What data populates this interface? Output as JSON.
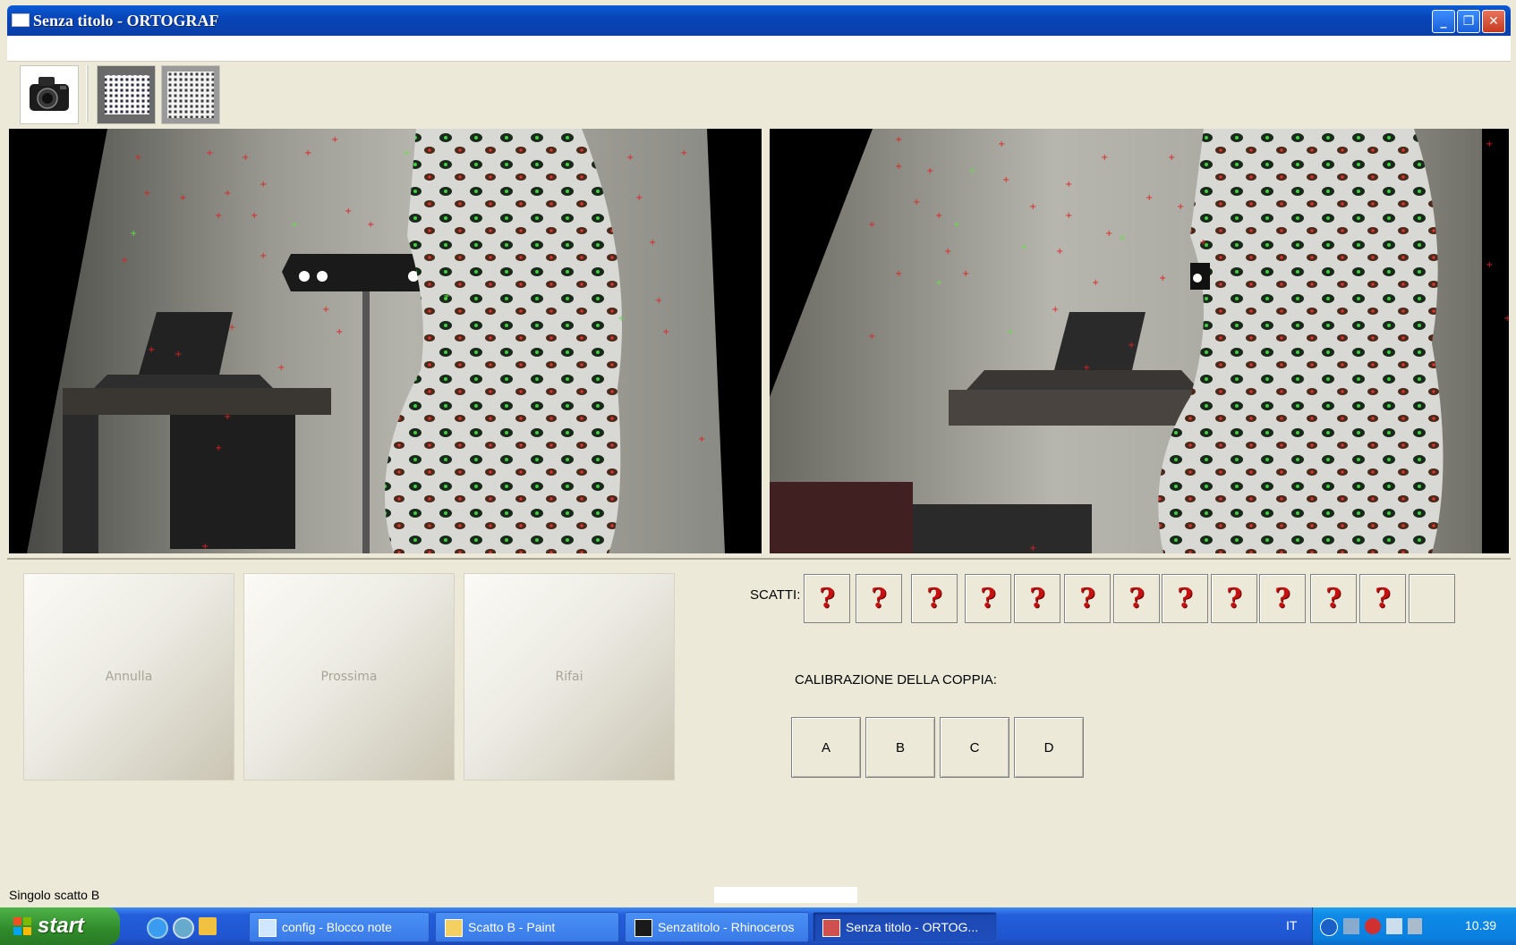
{
  "window": {
    "title": "Senza titolo - ORTOGRAF",
    "controls": [
      "minimize",
      "restore",
      "close"
    ]
  },
  "toolbar": {
    "buttons": [
      {
        "name": "camera-icon"
      },
      {
        "name": "calibration-grid-icon"
      },
      {
        "name": "calibration-grid-light-icon"
      }
    ]
  },
  "actions": {
    "cancel": "Annulla",
    "next": "Prossima",
    "redo": "Rifai"
  },
  "shots": {
    "label": "SCATTI:",
    "items": [
      "?",
      "?",
      "?",
      "?",
      "?",
      "?",
      "?",
      "?",
      "?",
      "?",
      "?",
      "?",
      ""
    ]
  },
  "calibration": {
    "label": "CALIBRAZIONE DELLA COPPIA:",
    "pairs": [
      "A",
      "B",
      "C",
      "D"
    ]
  },
  "status": {
    "text": "Singolo scatto B"
  },
  "taskbar": {
    "start": "start",
    "tasks": [
      {
        "label": "config - Blocco note",
        "icon": "notepad-icon"
      },
      {
        "label": "Scatto B - Paint",
        "icon": "paint-icon"
      },
      {
        "label": "Senzatitolo - Rhinoceros",
        "icon": "rhino-icon"
      },
      {
        "label": "Senza titolo - ORTOG...",
        "icon": "ortograf-icon",
        "active": true
      }
    ],
    "language": "IT",
    "clock": "10.39"
  }
}
